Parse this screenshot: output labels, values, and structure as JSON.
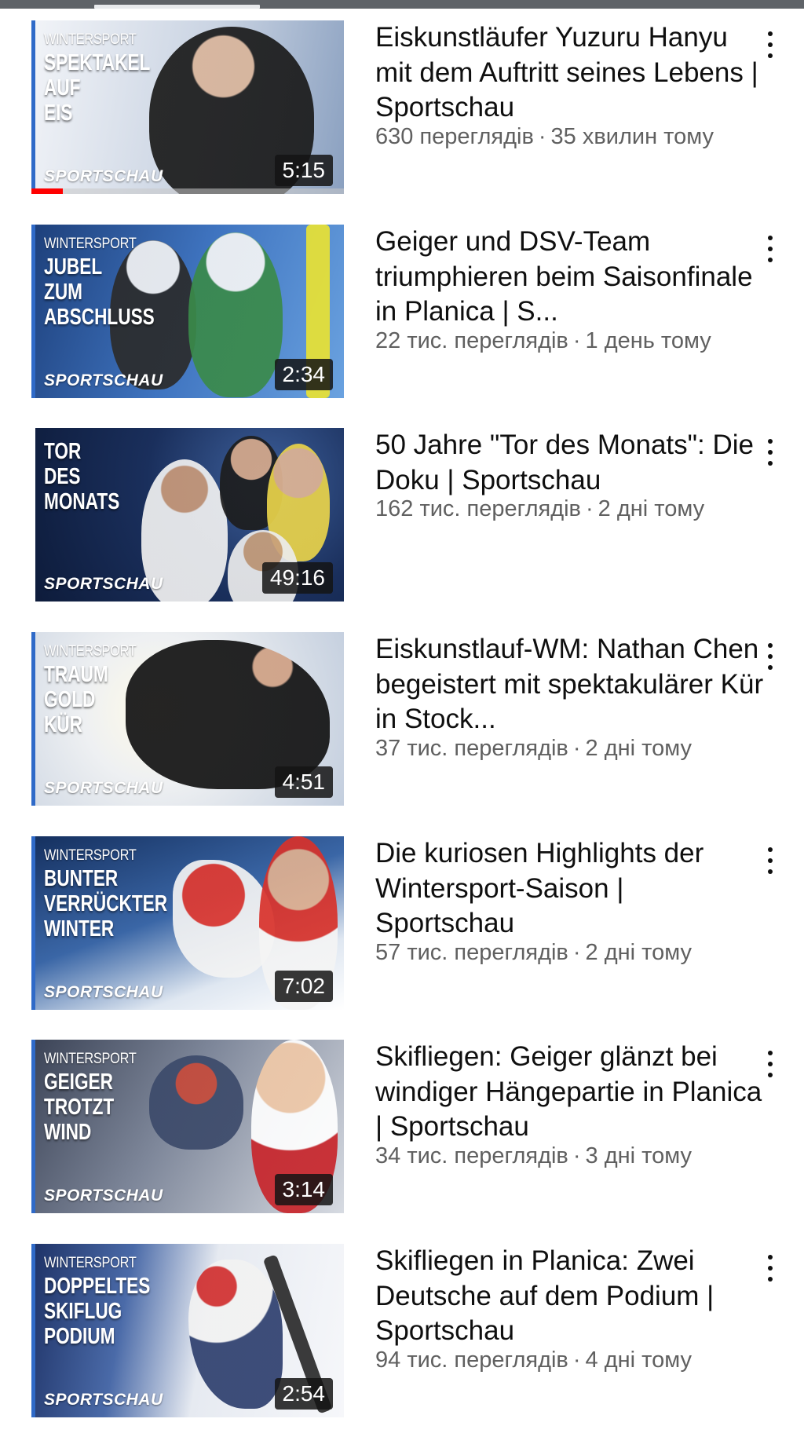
{
  "videos": [
    {
      "title": "Eiskunstläufer Yuzuru Hanyu mit dem Auftritt seines Lebens | Sportschau",
      "views": "630 переглядів",
      "age": "35 хвилин тому",
      "duration": "5:15",
      "thumb_kicker": "WINTERSPORT",
      "thumb_headline": "SPEKTAKEL\nAUF\nEIS",
      "thumb_brand": "SPORTSCHAU",
      "watch_progress": 0.1,
      "palette": {
        "bg1": "#f2f4f8",
        "bg2": "#c9d3e2",
        "accent": "#1a1a1a"
      }
    },
    {
      "title": "Geiger und DSV-Team triumphieren beim Saisonfinale in Planica | S...",
      "views": "22 тис. переглядів",
      "age": "1 день тому",
      "duration": "2:34",
      "thumb_kicker": "WINTERSPORT",
      "thumb_headline": "JUBEL\nZUM\nABSCHLUSS",
      "thumb_brand": "SPORTSCHAU",
      "palette": {
        "bg1": "#1d3f7a",
        "bg2": "#4d8bd6",
        "accent": "#e8e233"
      }
    },
    {
      "title": "50 Jahre \"Tor des Monats\": Die Doku | Sportschau",
      "views": "162 тис. переглядів",
      "age": "2 дні тому",
      "duration": "49:16",
      "thumb_kicker": "",
      "thumb_headline": "TOR\nDES\nMONATS",
      "thumb_brand": "SPORTSCHAU",
      "palette": {
        "bg1": "#0d1b3a",
        "bg2": "#2a4a80",
        "accent": "#f3f3f3"
      }
    },
    {
      "title": "Eiskunstlauf-WM: Nathan Chen begeistert mit spektakulärer Kür in Stock...",
      "views": "37 тис. переглядів",
      "age": "2 дні тому",
      "duration": "4:51",
      "thumb_kicker": "WINTERSPORT",
      "thumb_headline": "TRAUM\nGOLD\nKÜR",
      "thumb_brand": "SPORTSCHAU",
      "palette": {
        "bg1": "#f6f2ea",
        "bg2": "#c8d2e0",
        "accent": "#121212"
      }
    },
    {
      "title": "Die kuriosen Highlights der Wintersport-Saison | Sportschau",
      "views": "57 тис. переглядів",
      "age": "2 дні тому",
      "duration": "7:02",
      "thumb_kicker": "WINTERSPORT",
      "thumb_headline": "BUNTER\nVERRÜCKTER\nWINTER",
      "thumb_brand": "SPORTSCHAU",
      "palette": {
        "bg1": "#15305f",
        "bg2": "#7aa4d8",
        "accent": "#d8312a"
      }
    },
    {
      "title": "Skifliegen: Geiger glänzt bei windiger Hängepartie in Planica | Sportschau",
      "views": "34 тис. переглядів",
      "age": "3 дні тому",
      "duration": "3:14",
      "thumb_kicker": "WINTERSPORT",
      "thumb_headline": "GEIGER\nTROTZT\nWIND",
      "thumb_brand": "SPORTSCHAU",
      "palette": {
        "bg1": "#3b4356",
        "bg2": "#b9c0cc",
        "accent": "#c8252b"
      }
    },
    {
      "title": "Skifliegen in Planica: Zwei Deutsche auf dem Podium | Sportschau",
      "views": "94 тис. переглядів",
      "age": "4 дні тому",
      "duration": "2:54",
      "thumb_kicker": "WINTERSPORT",
      "thumb_headline": "DOPPELTES\nSKIFLUG\nPODIUM",
      "thumb_brand": "SPORTSCHAU",
      "palette": {
        "bg1": "#1e3266",
        "bg2": "#eef1f6",
        "accent": "#d12f2f"
      }
    }
  ],
  "separator": "·"
}
